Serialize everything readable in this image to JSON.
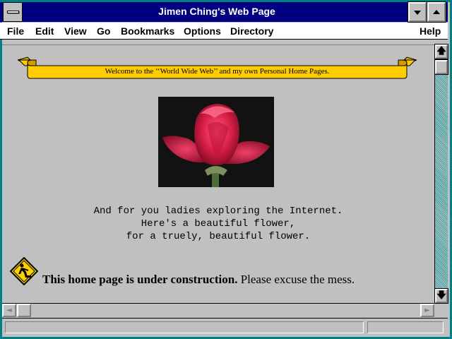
{
  "window": {
    "title": "Jimen Ching's Web Page"
  },
  "titlebar": {
    "system_menu_icon": "system-menu-icon",
    "minimize_icon": "minimize-arrow-icon",
    "maximize_icon": "maximize-arrow-icon"
  },
  "menubar": {
    "items": [
      {
        "label": "File"
      },
      {
        "label": "Edit"
      },
      {
        "label": "View"
      },
      {
        "label": "Go"
      },
      {
        "label": "Bookmarks"
      },
      {
        "label": "Options"
      },
      {
        "label": "Directory"
      },
      {
        "label": "Help"
      }
    ]
  },
  "page": {
    "banner_text": "Welcome to the ‘‘World Wide Web’’ and my own Personal Home Pages.",
    "image_subject": "red rose",
    "poem": "And for you ladies exploring the Internet.\nHere's a beautiful flower,\nfor a truely, beautiful flower.",
    "construction": {
      "bold": "This home page is under construction.",
      "rest": " Please excuse the mess.",
      "icon": "under-construction-sign-icon"
    }
  },
  "scrollbars": {
    "up_icon": "scroll-up-arrow-icon",
    "down_icon": "scroll-down-arrow-icon",
    "left_icon": "scroll-left-arrow-icon",
    "right_icon": "scroll-right-arrow-icon",
    "up_glyph": "🡅",
    "down_glyph": "🡇",
    "left_glyph": "◄",
    "right_glyph": "►"
  },
  "statusbar": {
    "text": ""
  },
  "colors": {
    "titlebar": "#000080",
    "window_frame": "#008080",
    "background": "#c0c0c0",
    "banner_yellow": "#ffcc00"
  }
}
